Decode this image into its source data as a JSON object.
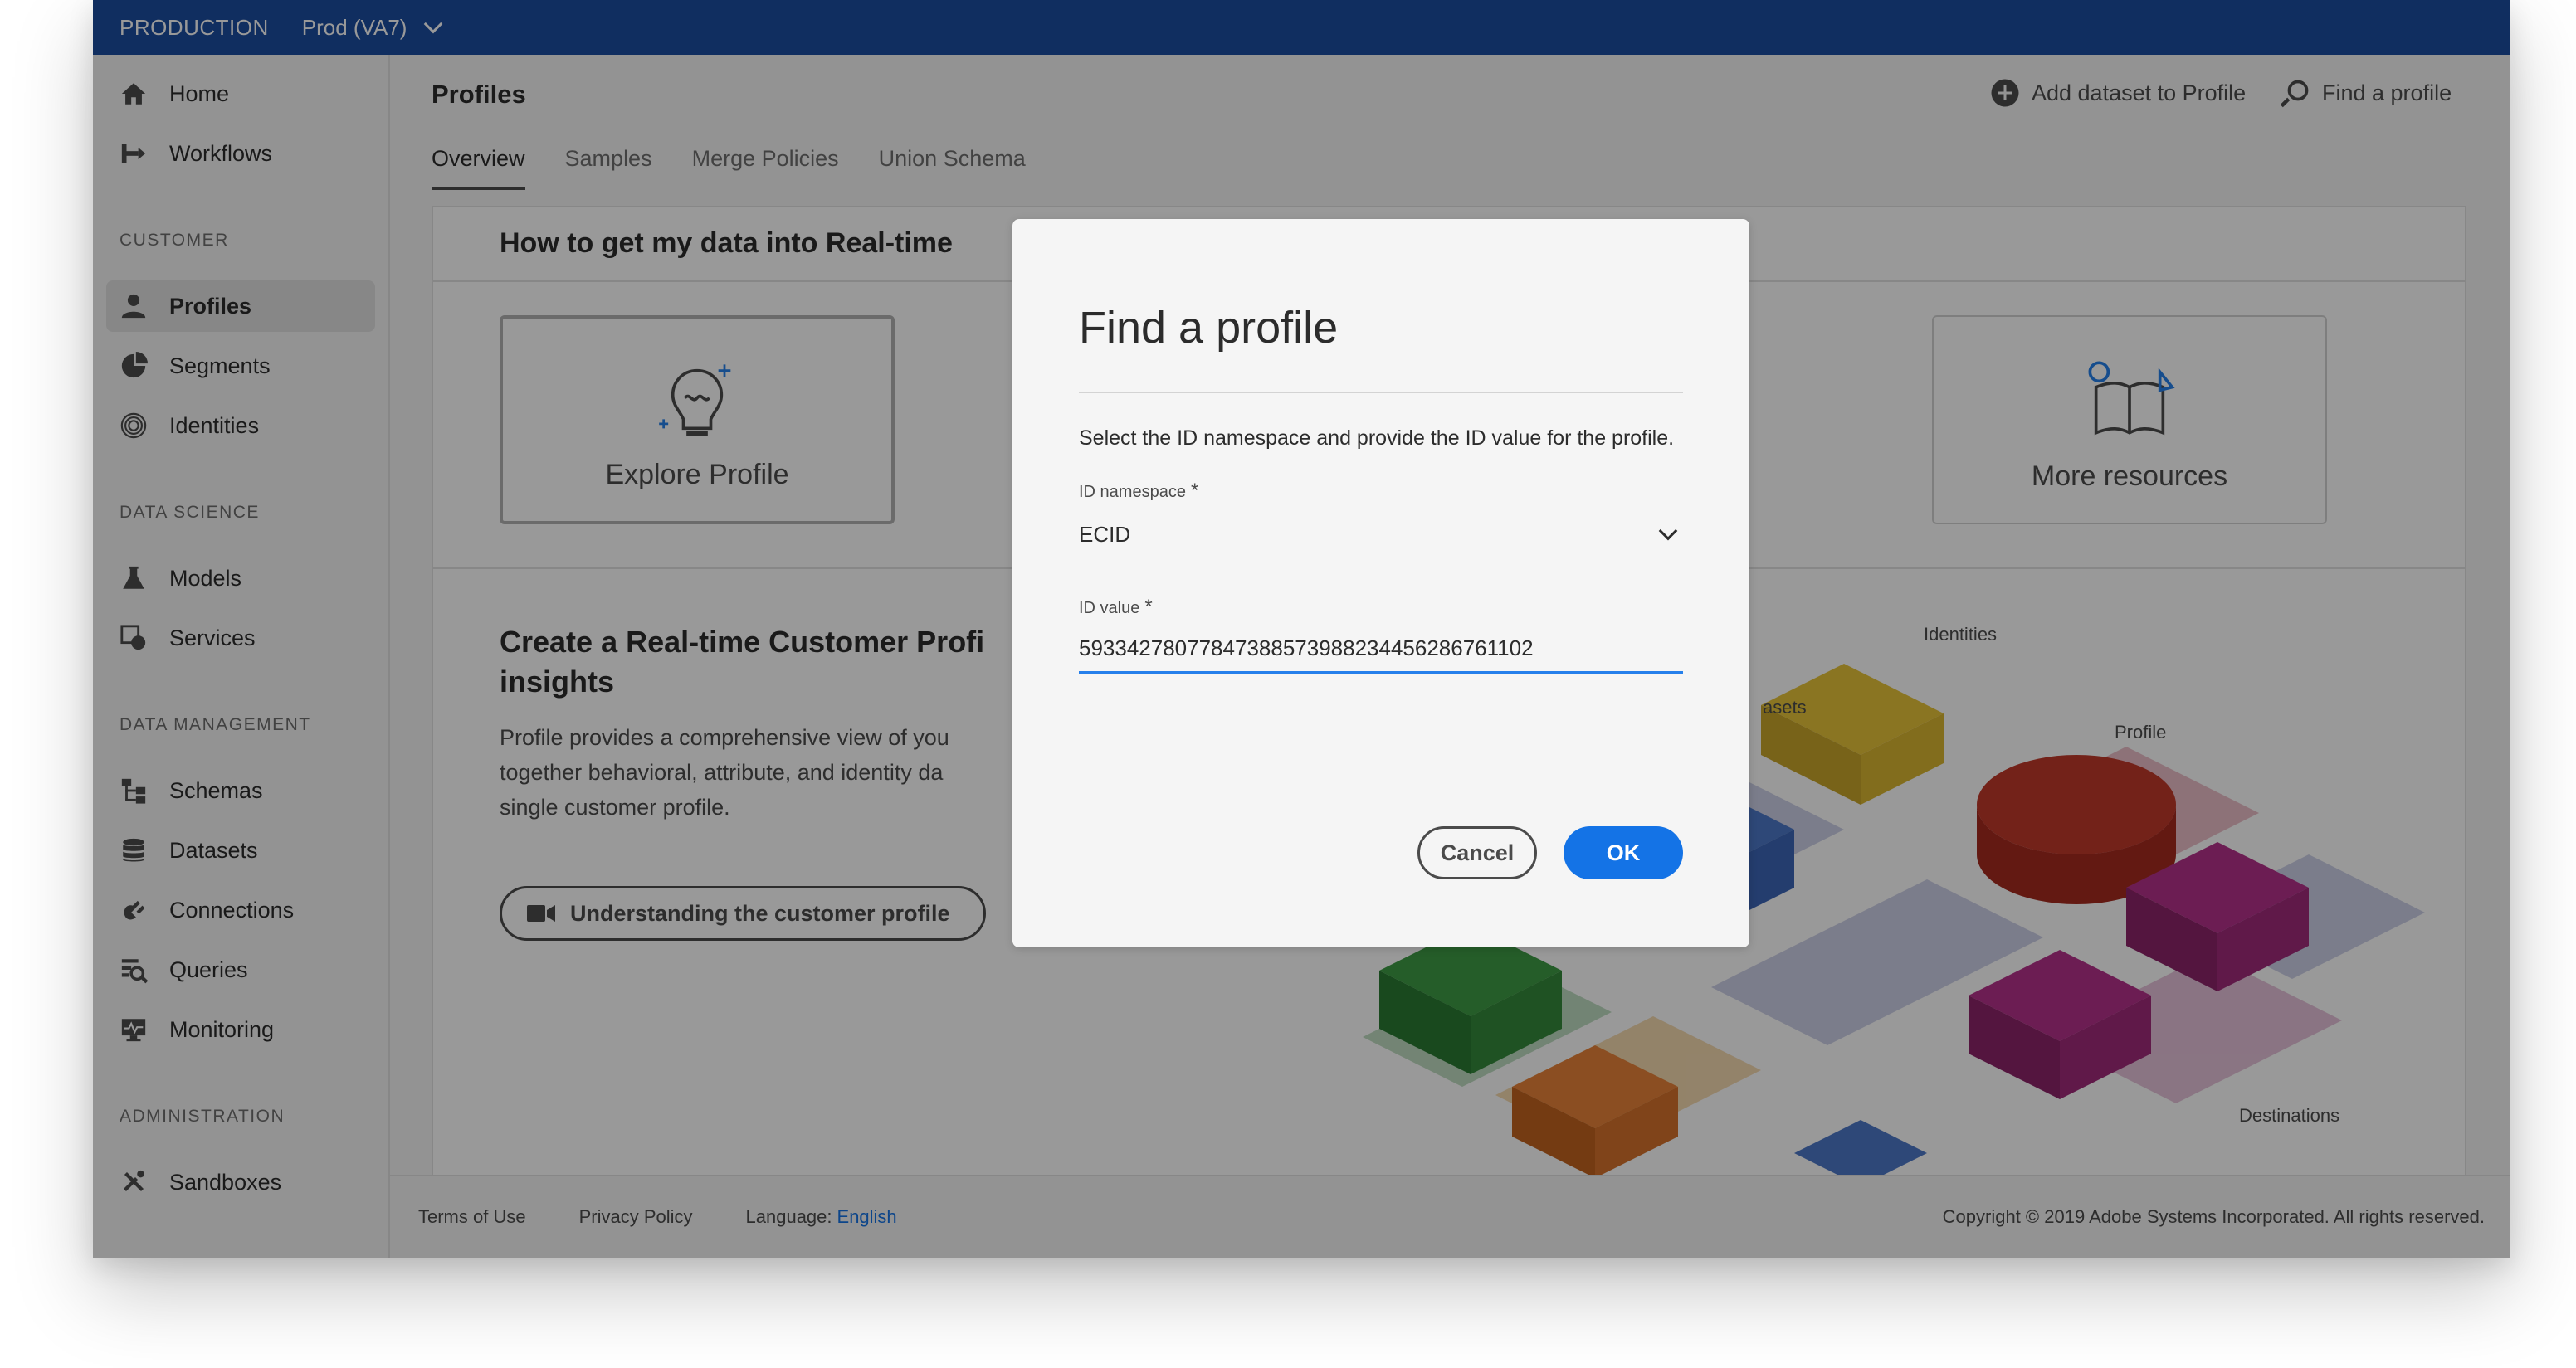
{
  "topbar": {
    "environment": "PRODUCTION",
    "sandbox": "Prod (VA7)"
  },
  "sidebar": {
    "top_items": [
      {
        "label": "Home",
        "icon": "home-icon"
      },
      {
        "label": "Workflows",
        "icon": "workflows-icon"
      }
    ],
    "sections": [
      {
        "title": "CUSTOMER",
        "items": [
          {
            "label": "Profiles",
            "icon": "profile-icon",
            "active": true
          },
          {
            "label": "Segments",
            "icon": "segments-icon"
          },
          {
            "label": "Identities",
            "icon": "fingerprint-icon"
          }
        ]
      },
      {
        "title": "DATA SCIENCE",
        "items": [
          {
            "label": "Models",
            "icon": "flask-icon"
          },
          {
            "label": "Services",
            "icon": "services-icon"
          }
        ]
      },
      {
        "title": "DATA MANAGEMENT",
        "items": [
          {
            "label": "Schemas",
            "icon": "schema-icon"
          },
          {
            "label": "Datasets",
            "icon": "database-icon"
          },
          {
            "label": "Connections",
            "icon": "plug-icon"
          },
          {
            "label": "Queries",
            "icon": "query-icon"
          },
          {
            "label": "Monitoring",
            "icon": "monitor-icon"
          }
        ]
      },
      {
        "title": "ADMINISTRATION",
        "items": [
          {
            "label": "Sandboxes",
            "icon": "tools-icon"
          }
        ]
      }
    ]
  },
  "header": {
    "title": "Profiles",
    "add_dataset": "Add dataset to Profile",
    "find_profile": "Find a profile"
  },
  "tabs": [
    {
      "label": "Overview",
      "active": true
    },
    {
      "label": "Samples"
    },
    {
      "label": "Merge Policies"
    },
    {
      "label": "Union Schema"
    }
  ],
  "card": {
    "title": "How to get my data into Real-time",
    "tiles": {
      "explore": "Explore Profile",
      "resources": "More resources"
    },
    "create_title": "Create a Real-time Customer Profi insights",
    "description": "Profile provides a comprehensive view of you together behavioral, attribute, and identity da single customer profile.",
    "video_button": "Understanding the customer profile"
  },
  "illustration": {
    "labels": {
      "identities": "Identities",
      "profile": "Profile",
      "datasets": "asets",
      "destinations": "Destinations"
    }
  },
  "footer": {
    "terms": "Terms of Use",
    "privacy": "Privacy Policy",
    "language_label": "Language:",
    "language_value": "English",
    "copyright": "Copyright © 2019 Adobe Systems Incorporated. All rights reserved."
  },
  "dialog": {
    "title": "Find a profile",
    "description": "Select the ID namespace and provide the ID value for the profile.",
    "namespace_label": "ID namespace",
    "namespace_value": "ECID",
    "value_label": "ID value",
    "value": "59334278077847388573988234456286761102",
    "required_mark": "*",
    "cancel": "Cancel",
    "ok": "OK"
  }
}
